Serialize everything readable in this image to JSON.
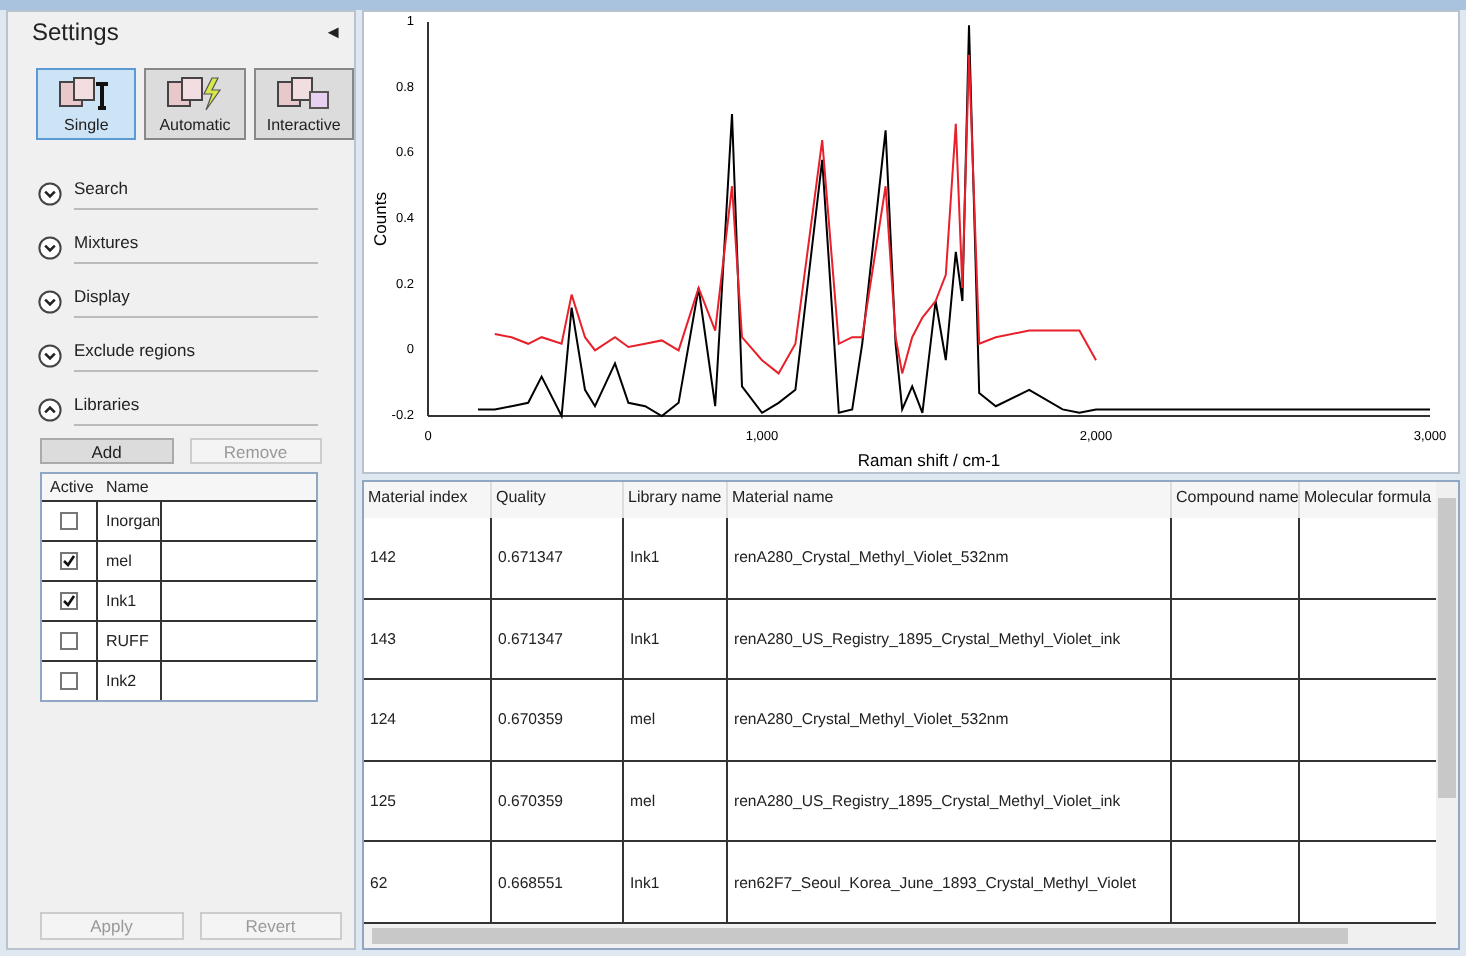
{
  "settings": {
    "title": "Settings",
    "collapse_glyph": "◄",
    "modes": [
      {
        "label": "Single",
        "selected": true
      },
      {
        "label": "Automatic",
        "selected": false
      },
      {
        "label": "Interactive",
        "selected": false
      }
    ],
    "sections": [
      {
        "label": "Search",
        "expanded": false
      },
      {
        "label": "Mixtures",
        "expanded": false
      },
      {
        "label": "Display",
        "expanded": false
      },
      {
        "label": "Exclude regions",
        "expanded": false
      },
      {
        "label": "Libraries",
        "expanded": true
      }
    ],
    "library_buttons": [
      {
        "label": "Add",
        "disabled": false
      },
      {
        "label": "Remove",
        "disabled": true
      }
    ],
    "library_columns": [
      "Active",
      "Name"
    ],
    "libraries": [
      {
        "name": "Inorgan",
        "checked": false
      },
      {
        "name": "mel",
        "checked": true
      },
      {
        "name": "Ink1",
        "checked": true
      },
      {
        "name": "RUFF",
        "checked": false
      },
      {
        "name": "Ink2",
        "checked": false
      }
    ],
    "footer_buttons": [
      {
        "label": "Apply",
        "disabled": true
      },
      {
        "label": "Revert",
        "disabled": true
      }
    ]
  },
  "chart": {
    "chart_data": {
      "type": "line",
      "xlabel": "Raman shift / cm-1",
      "ylabel": "Counts",
      "x": [
        150,
        200,
        250,
        300,
        340,
        400,
        430,
        470,
        500,
        560,
        600,
        650,
        700,
        750,
        810,
        860,
        910,
        940,
        1000,
        1050,
        1100,
        1180,
        1230,
        1270,
        1300,
        1370,
        1400,
        1420,
        1450,
        1480,
        1520,
        1550,
        1580,
        1600,
        1620,
        1650,
        1700,
        1800,
        1900,
        1950,
        2000,
        3000
      ],
      "series": [
        {
          "color": "#000000",
          "values": [
            -0.18,
            -0.18,
            -0.17,
            -0.16,
            -0.08,
            -0.2,
            0.13,
            -0.12,
            -0.17,
            -0.04,
            -0.16,
            -0.17,
            -0.2,
            -0.16,
            0.19,
            -0.17,
            0.72,
            -0.11,
            -0.19,
            -0.16,
            -0.12,
            0.58,
            -0.19,
            -0.18,
            0.02,
            0.67,
            0.02,
            -0.18,
            -0.11,
            -0.19,
            0.15,
            -0.03,
            0.3,
            0.15,
            0.99,
            -0.13,
            -0.17,
            -0.12,
            -0.18,
            -0.19,
            -0.18,
            -0.18
          ]
        },
        {
          "color": "#e8202a",
          "values": [
            null,
            0.05,
            0.04,
            0.02,
            0.04,
            0.02,
            0.17,
            0.04,
            0.0,
            0.04,
            0.01,
            0.02,
            0.03,
            0.0,
            0.19,
            0.06,
            0.5,
            0.04,
            -0.03,
            -0.07,
            0.02,
            0.64,
            0.02,
            0.04,
            0.04,
            0.5,
            0.04,
            -0.07,
            0.04,
            0.1,
            0.15,
            0.23,
            0.69,
            0.19,
            0.9,
            0.02,
            0.04,
            0.06,
            0.06,
            0.06,
            -0.03,
            null
          ]
        }
      ],
      "xlim": [
        0,
        3000
      ],
      "ylim": [
        -0.2,
        1
      ],
      "xticks": [
        0,
        {
          "value": 1000,
          "label": "1,000"
        },
        {
          "value": 2000,
          "label": "2,000"
        },
        {
          "value": 3000,
          "label": "3,000"
        }
      ],
      "yticks": [
        -0.2,
        0,
        0.2,
        0.4,
        0.6,
        0.8,
        1
      ]
    }
  },
  "results": {
    "columns": [
      "Material index",
      "Quality",
      "Library name",
      "Material name",
      "Compound name",
      "Molecular formula"
    ],
    "rows": [
      [
        "142",
        "0.671347",
        "Ink1",
        "renA280_Crystal_Methyl_Violet_532nm",
        "",
        ""
      ],
      [
        "143",
        "0.671347",
        "Ink1",
        "renA280_US_Registry_1895_Crystal_Methyl_Violet_ink",
        "",
        ""
      ],
      [
        "124",
        "0.670359",
        "mel",
        "renA280_Crystal_Methyl_Violet_532nm",
        "",
        ""
      ],
      [
        "125",
        "0.670359",
        "mel",
        "renA280_US_Registry_1895_Crystal_Methyl_Violet_ink",
        "",
        ""
      ],
      [
        "62",
        "0.668551",
        "Ink1",
        "ren62F7_Seoul_Korea_June_1893_Crystal_Methyl_Violet",
        "",
        ""
      ]
    ]
  }
}
